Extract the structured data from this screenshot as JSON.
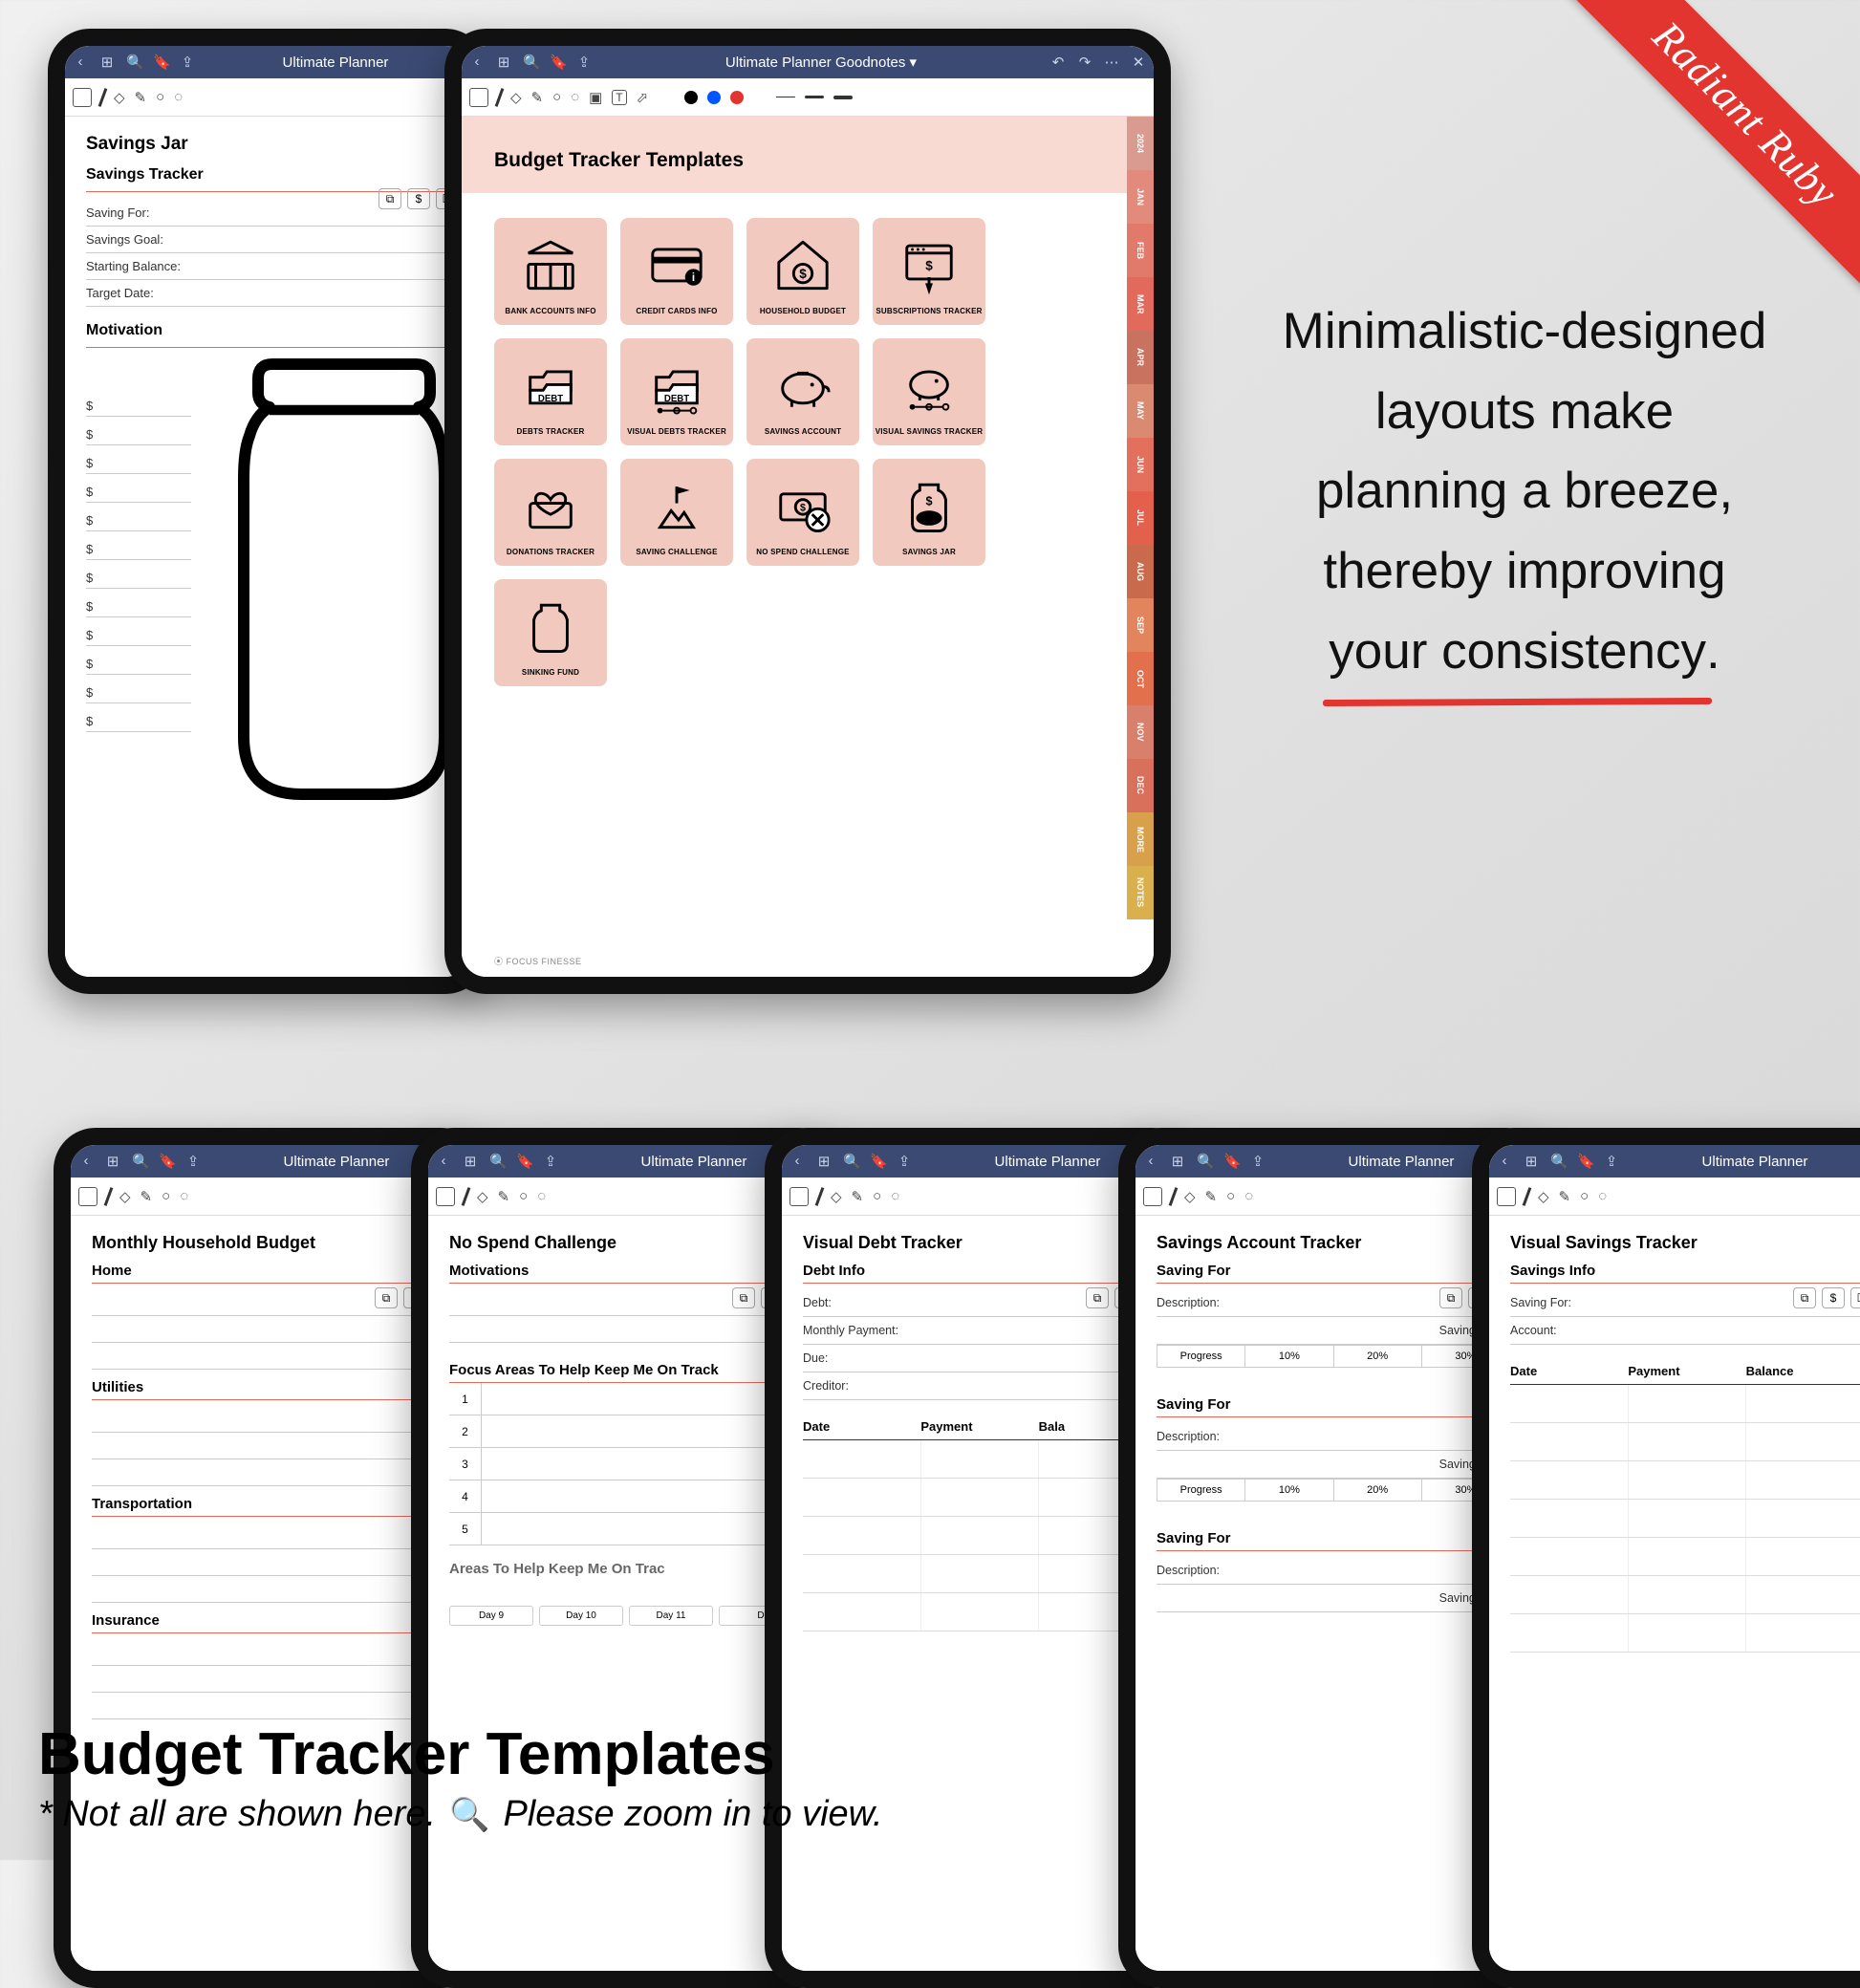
{
  "ribbon": {
    "label": "Radiant Ruby"
  },
  "marketing_copy": {
    "line1": "Minimalistic-designed",
    "line2": "layouts make",
    "line3": "planning a breeze,",
    "line4": "thereby improving",
    "underline": "your consistency",
    "tail": "."
  },
  "caption": {
    "title": "Budget Tracker Templates",
    "note1": "* Not all are shown here.",
    "note2": "Please zoom in to view."
  },
  "goodnotes": {
    "title_short": "Ultimate Planner",
    "title_full": "Ultimate Planner Goodnotes  ▾",
    "titlebar_icons_left": [
      "‹",
      "⊞",
      "🔍",
      "🔖",
      "⇪"
    ],
    "titlebar_icons_right": [
      "↶",
      "↷",
      "⋯",
      "✕"
    ],
    "toolbar2_colors": [
      "#000",
      "#0055ff",
      "#e2352f"
    ]
  },
  "savings_jar": {
    "h1": "Savings Jar",
    "h2_tracker": "Savings Tracker",
    "fields": [
      "Saving For:",
      "Savings Goal:",
      "Starting Balance:",
      "Target Date:"
    ],
    "h2_motivation": "Motivation",
    "dollar_lines": [
      "$",
      "$",
      "$",
      "$",
      "$",
      "$",
      "$",
      "$",
      "$",
      "$",
      "$",
      "$"
    ]
  },
  "budget_grid": {
    "header": "Budget Tracker Templates",
    "tiles": [
      "BANK ACCOUNTS INFO",
      "CREDIT CARDS INFO",
      "HOUSEHOLD BUDGET",
      "SUBSCRIPTIONS TRACKER",
      "DEBTS TRACKER",
      "VISUAL DEBTS TRACKER",
      "SAVINGS ACCOUNT",
      "VISUAL SAVINGS TRACKER",
      "DONATIONS TRACKER",
      "SAVING CHALLENGE",
      "NO SPEND CHALLENGE",
      "SAVINGS JAR",
      "SINKING FUND"
    ],
    "tabs": [
      {
        "l": "2024",
        "c": "#d99a8f"
      },
      {
        "l": "JAN",
        "c": "#e28a7c"
      },
      {
        "l": "FEB",
        "c": "#e27a6c"
      },
      {
        "l": "MAR",
        "c": "#e26a5c"
      },
      {
        "l": "APR",
        "c": "#c97260"
      },
      {
        "l": "MAY",
        "c": "#d98a70"
      },
      {
        "l": "JUN",
        "c": "#e2705c"
      },
      {
        "l": "JUL",
        "c": "#e2604c"
      },
      {
        "l": "AUG",
        "c": "#c96a4c"
      },
      {
        "l": "SEP",
        "c": "#e2855c"
      },
      {
        "l": "OCT",
        "c": "#e2704c"
      },
      {
        "l": "NOV",
        "c": "#d9806c"
      },
      {
        "l": "DEC",
        "c": "#d9705c"
      },
      {
        "l": "MORE",
        "c": "#d9a04c"
      },
      {
        "l": "NOTES",
        "c": "#d9b04c"
      }
    ],
    "brand": "FOCUS FINESSE"
  },
  "bottom": [
    {
      "title": "Monthly Household Budget",
      "sections": [
        "Home",
        "Utilities",
        "Transportation",
        "Insurance"
      ]
    },
    {
      "title": "No Spend Challenge",
      "h2a": "Motivations",
      "h2b": "Focus Areas To Help Keep Me On Track",
      "nums": [
        "1",
        "2",
        "3",
        "4",
        "5"
      ],
      "h2c": "Areas To Help Keep Me On Trac",
      "days": [
        "Day 9",
        "Day 10",
        "Day 11",
        "D"
      ]
    },
    {
      "title": "Visual Debt Tracker",
      "h2": "Debt Info",
      "fields": [
        "Debt:",
        "Monthly Payment:",
        "Due:",
        "Creditor:"
      ],
      "cols": [
        "Date",
        "Payment",
        "Bala"
      ]
    },
    {
      "title": "Savings Account Tracker",
      "h2": "Saving For",
      "desc": "Description:",
      "goal": "Savings Goal",
      "prog_label": "Progress",
      "prog": [
        "10%",
        "20%",
        "30%"
      ]
    },
    {
      "title": "Visual Savings Tracker",
      "h2": "Savings Info",
      "fields": [
        "Saving For:",
        "Account:"
      ],
      "cols": [
        "Date",
        "Payment",
        "Balance"
      ]
    }
  ]
}
